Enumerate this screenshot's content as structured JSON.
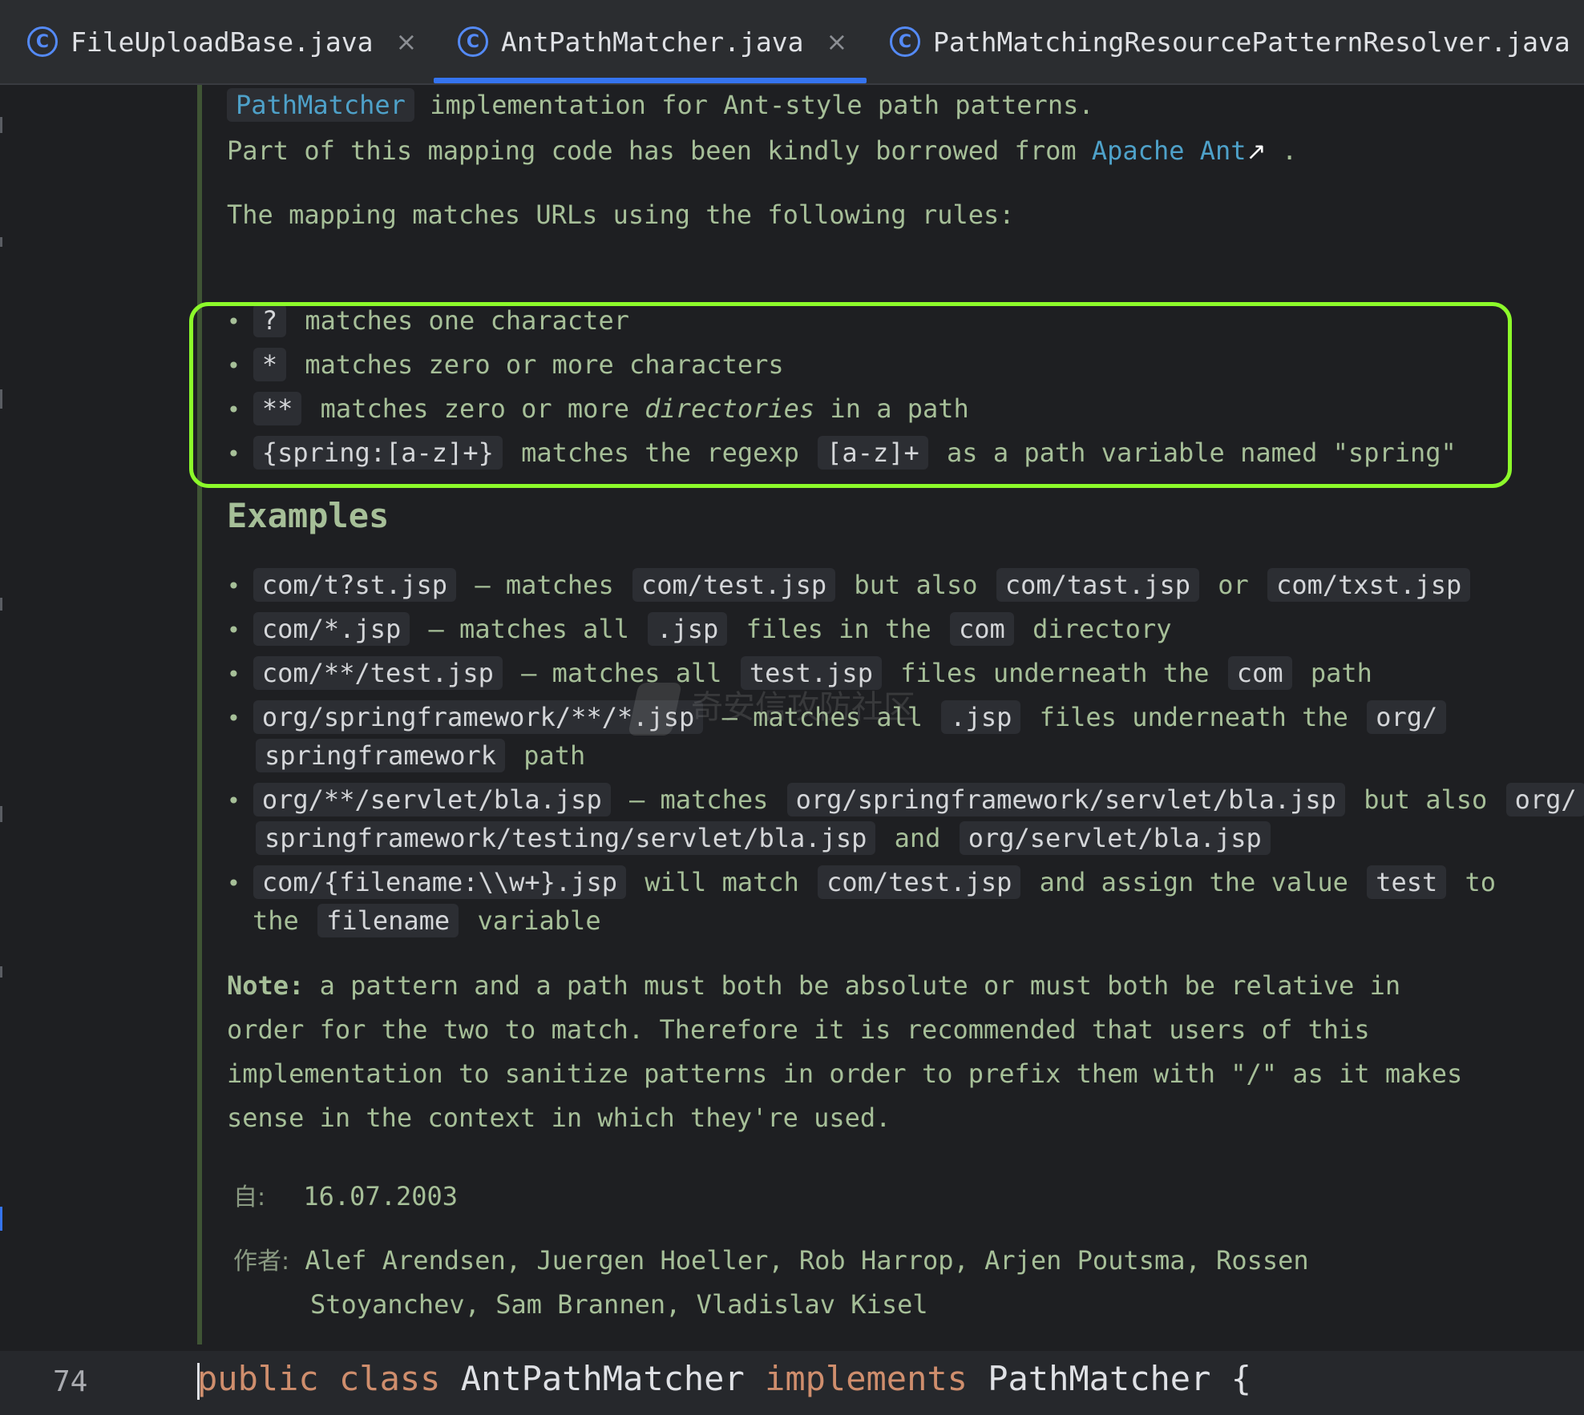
{
  "tabs": [
    {
      "label": "FileUploadBase.java",
      "icon": "class-icon",
      "close": "×"
    },
    {
      "label": "AntPathMatcher.java",
      "icon": "class-icon",
      "close": "×",
      "active": true
    },
    {
      "label": "PathMatchingResourcePatternResolver.java",
      "icon": "class-icon"
    }
  ],
  "icon_glyph": "C",
  "doc": {
    "intro_chip": "PathMatcher",
    "intro_rest": "implementation for Ant-style path patterns.",
    "borrowed_text": "Part of this mapping code has been kindly borrowed from",
    "borrowed_link": "Apache Ant",
    "borrowed_arrow": "↗",
    "borrowed_end": ".",
    "rules_intro": "The mapping matches URLs using the following rules:",
    "rules": [
      {
        "chip": "?",
        "text": "matches one character"
      },
      {
        "chip": "*",
        "text": "matches zero or more characters"
      },
      {
        "chip": "**",
        "text_a": "matches zero or more",
        "italic": "directories",
        "text_b": "in a path"
      },
      {
        "chip": "{spring:[a-z]+}",
        "text_a": "matches the regexp",
        "chip2": "[a-z]+",
        "text_b": "as a path variable named \"spring\""
      }
    ],
    "examples_heading": "Examples",
    "examples": {
      "e1": {
        "c1": "com/t?st.jsp",
        "t1": "— matches",
        "c2": "com/test.jsp",
        "t2": "but also",
        "c3": "com/tast.jsp",
        "t3": "or",
        "c4": "com/txst.jsp"
      },
      "e2": {
        "c1": "com/*.jsp",
        "t1": "— matches all",
        "c2": ".jsp",
        "t2": "files in the",
        "c3": "com",
        "t3": "directory"
      },
      "e3": {
        "c1": "com/**/test.jsp",
        "t1": "— matches all",
        "c2": "test.jsp",
        "t2": "files underneath the",
        "c3": "com",
        "t3": "path"
      },
      "e4": {
        "c1": "org/springframework/**/*.jsp",
        "t1": "— matches all",
        "c2": ".jsp",
        "t2": "files underneath the",
        "c3": "org/",
        "c4": "springframework",
        "t3": "path"
      },
      "e5": {
        "c1": "org/**/servlet/bla.jsp",
        "t1": "— matches",
        "c2": "org/springframework/servlet/bla.jsp",
        "t2": "but also",
        "c3": "org/",
        "c4": "springframework/testing/servlet/bla.jsp",
        "t3": "and",
        "c5": "org/servlet/bla.jsp"
      },
      "e6": {
        "c1": "com/{filename:\\\\w+}.jsp",
        "t1": "will match",
        "c2": "com/test.jsp",
        "t2": "and assign the value",
        "c3": "test",
        "t3": "to",
        "t4": "the",
        "c4": "filename",
        "t5": "variable"
      }
    },
    "note_label": "Note:",
    "note_lines": [
      "a pattern and a path must both be absolute or must both be relative in",
      "order for the two to match. Therefore it is recommended that users of this",
      "implementation to sanitize patterns in order to prefix them with \"/\" as it makes",
      "sense in the context in which they're used."
    ],
    "since_label": "自:",
    "since_value": "16.07.2003",
    "author_label": "作者:",
    "author_line1": "Alef Arendsen, Juergen Hoeller, Rob Harrop, Arjen Poutsma, Rossen",
    "author_line2": "Stoyanchev, Sam Brannen, Vladislav Kisel"
  },
  "code": {
    "line_number": "74",
    "kw_public": "public",
    "kw_class": "class",
    "class_name": "AntPathMatcher",
    "kw_implements": "implements",
    "iface": "PathMatcher",
    "brace": "{"
  },
  "watermark": "奇安信攻防社区",
  "colors": {
    "accent": "#3574f0",
    "highlight": "#8cfa2a",
    "keyword": "#cf8e6d",
    "doc_text": "#a6bf98",
    "link": "#4ea1c9"
  }
}
